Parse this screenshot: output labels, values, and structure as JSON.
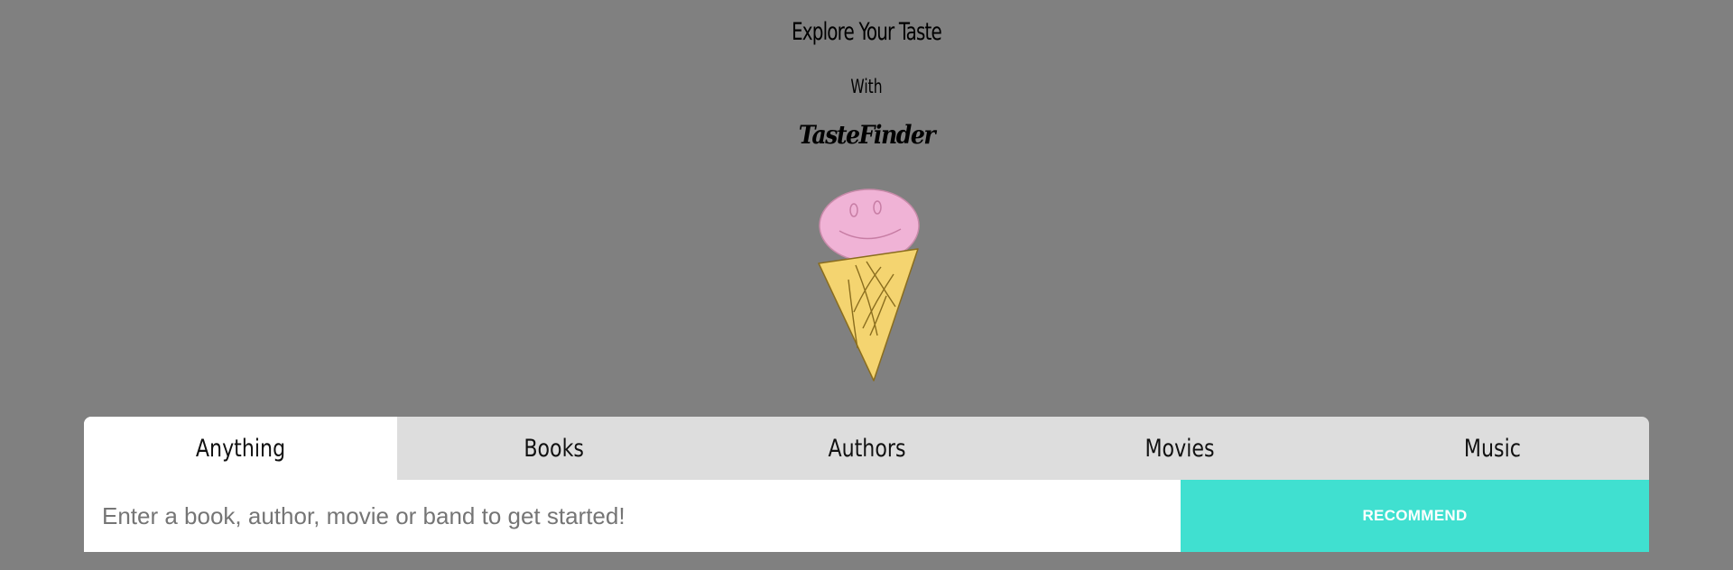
{
  "header": {
    "title": "Explore Your Taste",
    "connector": "With",
    "brand": "TasteFinder"
  },
  "mascot": {
    "icon": "ice-cream-cone-icon",
    "scoop_color": "#f0b3d6",
    "cone_color": "#f4d470"
  },
  "tabs": [
    {
      "label": "Anything",
      "active": true
    },
    {
      "label": "Books",
      "active": false
    },
    {
      "label": "Authors",
      "active": false
    },
    {
      "label": "Movies",
      "active": false
    },
    {
      "label": "Music",
      "active": false
    }
  ],
  "search": {
    "value": "",
    "placeholder": "Enter a book, author, movie or band to get started!"
  },
  "recommend_button": {
    "label": "RECOMMEND"
  },
  "colors": {
    "background": "#808080",
    "accent": "#40e0d0",
    "tab_inactive": "#dddddd",
    "tab_active": "#ffffff"
  }
}
